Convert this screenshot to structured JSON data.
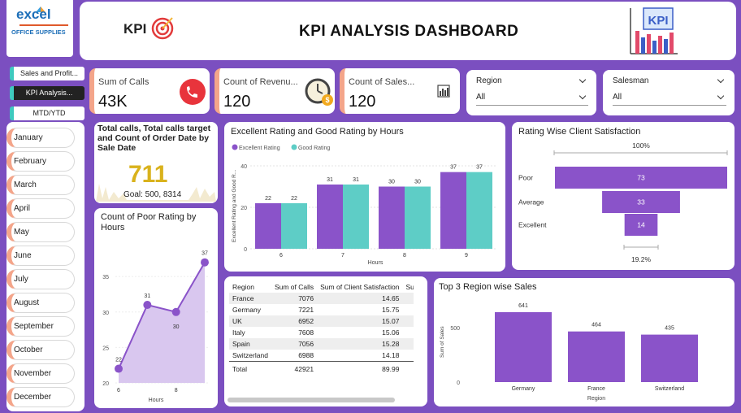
{
  "header": {
    "title": "KPI ANALYSIS DASHBOARD",
    "kpi_text": "KPI",
    "logo_line1": "excel",
    "logo_line2": "OFFICE SUPPLIES",
    "badge_text": "KPI"
  },
  "nav": {
    "items": [
      "Sales and Profit...",
      "KPI Analysis...",
      "MTD/YTD"
    ],
    "active": "KPI Analysis..."
  },
  "months": [
    "January",
    "February",
    "March",
    "April",
    "May",
    "June",
    "July",
    "August",
    "September",
    "October",
    "November",
    "December"
  ],
  "cards": [
    {
      "label": "Sum of Calls",
      "value": "43K",
      "icon": "phone-icon"
    },
    {
      "label": "Count of Revenu...",
      "value": "120",
      "icon": "clock-money-icon"
    },
    {
      "label": "Count of Sales...",
      "value": "120",
      "icon": "bar-chart-icon"
    }
  ],
  "filters": [
    {
      "label": "Region",
      "value": "All"
    },
    {
      "label": "Salesman",
      "value": "All"
    }
  ],
  "gauge": {
    "title": "Total calls, Total calls target and Count of Order Date by Sale Date",
    "value": "711",
    "goal": "Goal: 500, 8314"
  },
  "colors": {
    "purple": "#8a53c9",
    "teal": "#5ecdc6",
    "accent": "#7b4fc0",
    "card_edge": "#f4a58a"
  },
  "chart_data": [
    {
      "type": "bar",
      "title": "Excellent Rating and Good Rating by Hours",
      "xlabel": "Hours",
      "ylabel": "Excellent Rating and Good R...",
      "categories": [
        "6",
        "7",
        "8",
        "9"
      ],
      "series": [
        {
          "name": "Excellent Rating",
          "values": [
            22,
            31,
            30,
            37
          ]
        },
        {
          "name": "Good Rating",
          "values": [
            22,
            31,
            30,
            37
          ]
        }
      ],
      "yticks": [
        "0",
        "20",
        "40"
      ],
      "ylim": [
        0,
        40
      ],
      "legend": "top-left"
    },
    {
      "type": "bar",
      "title": "Rating Wise Client Satisfaction",
      "categories": [
        "Poor",
        "Average",
        "Excellent"
      ],
      "values": [
        73,
        33,
        14
      ],
      "top_label": "100%",
      "bottom_label": "19.2%"
    },
    {
      "type": "area",
      "title": "Count of Poor Rating by Hours",
      "xlabel": "Hours",
      "x": [
        6,
        7,
        8,
        9
      ],
      "y": [
        22,
        31,
        30,
        37
      ],
      "point_labels": [
        "22",
        "31",
        "30",
        "37"
      ],
      "yticks": [
        "20",
        "25",
        "30",
        "35"
      ],
      "xticks": [
        "6",
        "8"
      ],
      "ylim": [
        20,
        38
      ]
    },
    {
      "type": "table",
      "columns": [
        "Region",
        "Sum of Calls",
        "Sum of Client Satisfaction",
        "Sum"
      ],
      "rows": [
        [
          "France",
          "7076",
          "14.65"
        ],
        [
          "Germany",
          "7221",
          "15.75"
        ],
        [
          "UK",
          "6952",
          "15.07"
        ],
        [
          "Italy",
          "7608",
          "15.06"
        ],
        [
          "Spain",
          "7056",
          "15.28"
        ],
        [
          "Switzerland",
          "6988",
          "14.18"
        ]
      ],
      "total": [
        "Total",
        "42921",
        "89.99"
      ]
    },
    {
      "type": "bar",
      "title": "Top 3 Region wise Sales",
      "xlabel": "Region",
      "ylabel": "Sum of Sales",
      "categories": [
        "Germany",
        "France",
        "Switzerland"
      ],
      "values": [
        641,
        464,
        435
      ],
      "yticks": [
        "0",
        "500"
      ],
      "ylim": [
        0,
        700
      ]
    }
  ]
}
